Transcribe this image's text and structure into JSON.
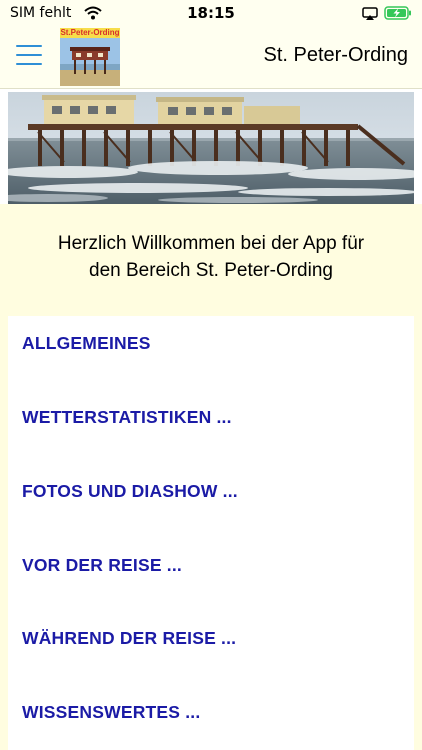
{
  "status_bar": {
    "carrier": "SIM fehlt",
    "time": "18:15",
    "wifi_icon": "wifi-icon",
    "airplay_icon": "airplay-icon",
    "battery_icon": "battery-charging-icon",
    "battery_color": "#35c759"
  },
  "navbar": {
    "title": "St. Peter-Ording",
    "logo_text": "St.Peter-Ording",
    "menu_icon": "hamburger-menu-icon",
    "menu_icon_color": "#2f8fd6"
  },
  "hero": {
    "image_subject": "stilt house on the beach with surf"
  },
  "welcome": {
    "line1": "Herzlich Willkommen bei der App für",
    "line2": "den Bereich St. Peter-Ording"
  },
  "menu": {
    "link_color": "#1b1ba6",
    "items": [
      {
        "label": "ALLGEMEINES"
      },
      {
        "label": "WETTERSTATISTIKEN ..."
      },
      {
        "label": "FOTOS UND DIASHOW ..."
      },
      {
        "label": "VOR DER REISE ..."
      },
      {
        "label": "WÄHREND DER REISE ..."
      },
      {
        "label": "WISSENSWERTES ..."
      }
    ]
  }
}
